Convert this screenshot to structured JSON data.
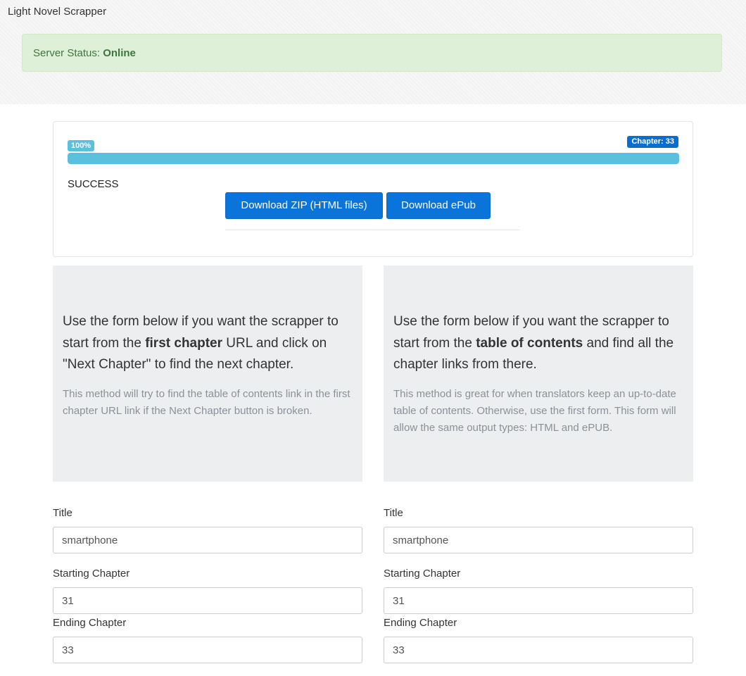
{
  "app": {
    "brand": "Light Novel Scrapper"
  },
  "server_status": {
    "label": "Server Status:",
    "value": "Online"
  },
  "progress": {
    "percent_label": "100%",
    "percent_value": 100,
    "chapter_label": "Chapter: 33",
    "status_text": "SUCCESS",
    "download_zip_label": "Download ZIP (HTML files)",
    "download_epub_label": "Download ePub"
  },
  "panels": {
    "left": {
      "lead_before": "Use the form below if you want the scrapper to start from the ",
      "lead_bold": "first chapter",
      "lead_after": " URL and click on \"Next Chapter\" to find the next chapter.",
      "note": "This method will try to find the table of contents link in the first chapter URL link if the Next Chapter button is broken."
    },
    "right": {
      "lead_before": "Use the form below if you want the scrapper to start from the ",
      "lead_bold": "table of contents",
      "lead_after": " and find all the chapter links from there.",
      "note": "This method is great for when translators keep an up-to-date table of contents. Otherwise, use the first form. This form will allow the same output types: HTML and ePUB."
    }
  },
  "forms": {
    "left": {
      "title_label": "Title",
      "title_value": "smartphone",
      "start_label": "Starting Chapter",
      "start_value": "31",
      "end_label": "Ending Chapter",
      "end_value": "33"
    },
    "right": {
      "title_label": "Title",
      "title_value": "smartphone",
      "start_label": "Starting Chapter",
      "start_value": "31",
      "end_label": "Ending Chapter",
      "end_value": "33"
    }
  },
  "colors": {
    "success_bg": "#dff0d8",
    "success_text": "#3c763d",
    "progress_fill": "#5bc0de",
    "primary_button": "#0a74da",
    "chapter_badge": "#0a6ed1",
    "panel_bg": "#eceeef"
  }
}
